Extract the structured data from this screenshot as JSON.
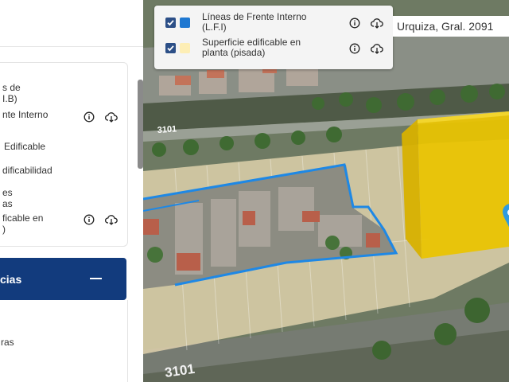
{
  "sidebar": {
    "layers": [
      {
        "line1": "s de",
        "line2": "I.B)",
        "has_actions": false
      },
      {
        "line1": "nte Interno",
        "line2": "",
        "has_actions": true
      },
      {
        "line1": "Edificable",
        "line2": "",
        "has_actions": false
      },
      {
        "line1": "dificabilidad",
        "line2": "",
        "has_actions": false
      },
      {
        "line1": "es",
        "line2": "as",
        "has_actions": false
      },
      {
        "line1": "ficable en",
        "line2": ")",
        "has_actions": true
      }
    ],
    "accordion": {
      "label": "cias",
      "toggle": "collapse"
    },
    "lower_items": [
      "ras"
    ]
  },
  "legend": {
    "items": [
      {
        "label_line1": "Líneas de Frente Interno",
        "label_line2": "(L.F.I)",
        "color": "#1f78d1",
        "checked": true
      },
      {
        "label_line1": "Superficie edificable en",
        "label_line2": "planta (pisada)",
        "color": "#fdeeb5",
        "checked": true
      }
    ]
  },
  "address": {
    "text": "Urquiza, Gral. 2091"
  },
  "map": {
    "street_numbers": [
      "3101",
      "3101"
    ],
    "colors": {
      "building": "#e9c400",
      "lot_outline": "#1e88e5",
      "buildable": "#fbe7bc"
    }
  },
  "icons": {
    "info": "info-icon",
    "download": "cloud-download-icon",
    "marker": "map-pin-icon"
  }
}
